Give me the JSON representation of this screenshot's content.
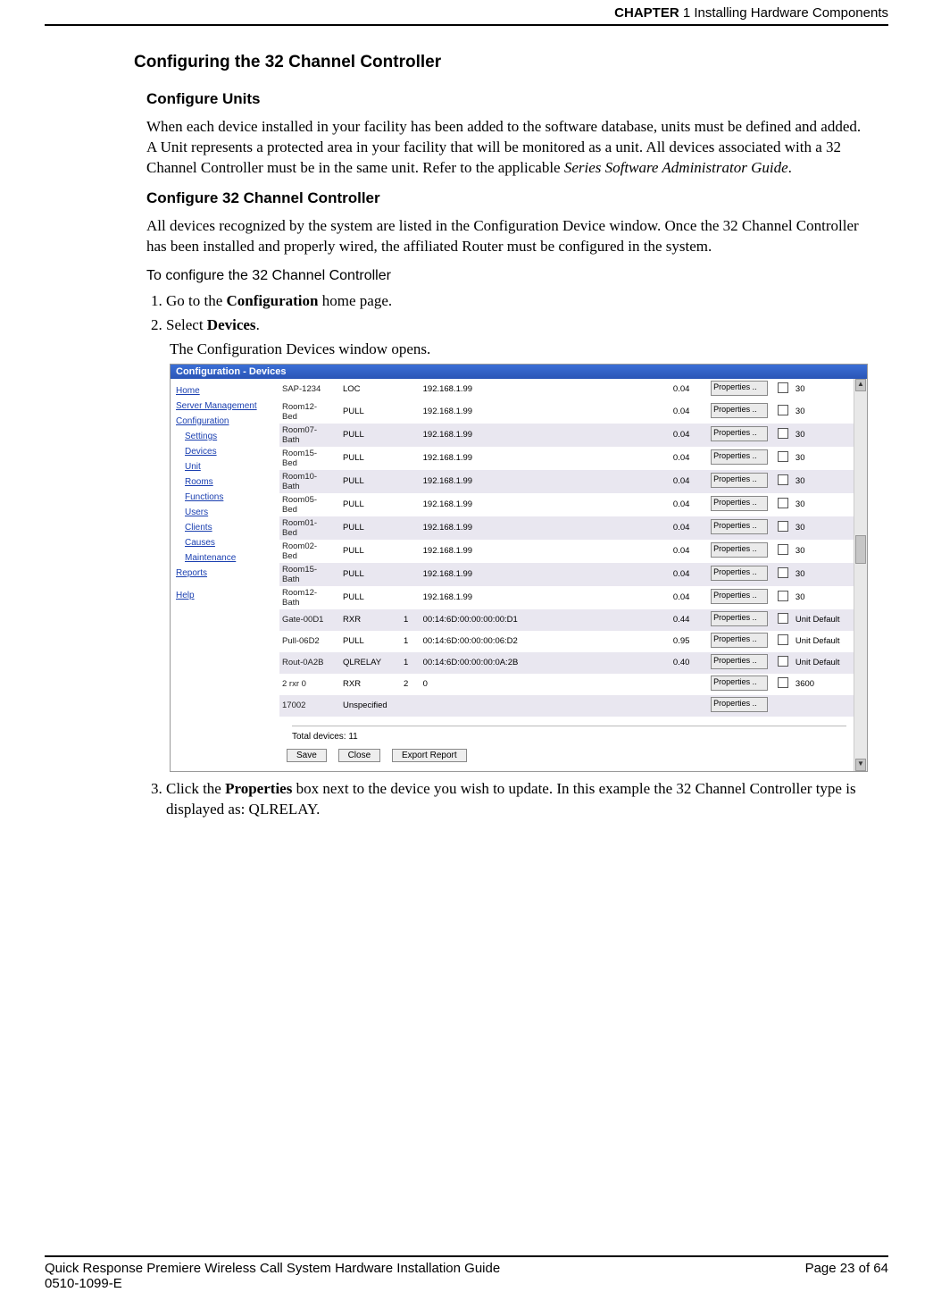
{
  "header": {
    "chapter_label": "CHAPTER",
    "chapter_num": "1",
    "chapter_title": "Installing Hardware Components"
  },
  "section": {
    "title": "Configuring the 32 Channel Controller",
    "sub1": {
      "title": "Configure Units",
      "para": "When each device installed in your facility has been added to the software database, units must be defined and added. A Unit represents a protected area in your facility that will be monitored as a unit. All devices associated with a 32 Channel Controller must be in the same unit. Refer to the applicable ",
      "para_ital": "Series Software Administrator Guide",
      "para_end": "."
    },
    "sub2": {
      "title": "Configure 32 Channel Controller",
      "para": "All devices recognized by the system are listed in the Configuration Device window. Once the 32 Channel Controller has been installed and properly wired, the affiliated Router must be configured in the system.",
      "lead": "To configure the 32 Channel Controller",
      "step1_pre": "Go to the ",
      "step1_bold": "Configuration",
      "step1_post": " home page.",
      "step2_pre": "Select ",
      "step2_bold": "Devices",
      "step2_post": ".",
      "after2": "The Configuration Devices window opens.",
      "step3_pre": "Click the ",
      "step3_bold": "Properties",
      "step3_post": " box next to the device you wish to update. In this example the 32 Channel Controller type is displayed as: QLRELAY."
    }
  },
  "shot": {
    "title": "Configuration - Devices",
    "sidebar": {
      "items": [
        {
          "label": "Home",
          "indent": false
        },
        {
          "label": "Server Management",
          "indent": false
        },
        {
          "label": "Configuration",
          "indent": false
        },
        {
          "label": "Settings",
          "indent": true
        },
        {
          "label": "Devices",
          "indent": true
        },
        {
          "label": "Unit",
          "indent": true
        },
        {
          "label": "Rooms",
          "indent": true
        },
        {
          "label": "Functions",
          "indent": true
        },
        {
          "label": "Users",
          "indent": true
        },
        {
          "label": "Clients",
          "indent": true
        },
        {
          "label": "Causes",
          "indent": true
        },
        {
          "label": "Maintenance",
          "indent": true
        },
        {
          "label": "Reports",
          "indent": false
        },
        {
          "label": "Help",
          "indent": false
        }
      ]
    },
    "prop_label": "Properties ..",
    "rows": [
      {
        "alt": false,
        "name": "SAP-1234",
        "type": "LOC",
        "n1": "",
        "addr": "192.168.1.99",
        "num": "0.04",
        "cb": true,
        "rt": "30"
      },
      {
        "alt": false,
        "name": "Room12-Bed",
        "type": "PULL",
        "n1": "",
        "addr": "192.168.1.99",
        "num": "0.04",
        "cb": true,
        "rt": "30"
      },
      {
        "alt": true,
        "name": "Room07-Bath",
        "type": "PULL",
        "n1": "",
        "addr": "192.168.1.99",
        "num": "0.04",
        "cb": true,
        "rt": "30"
      },
      {
        "alt": false,
        "name": "Room15-Bed",
        "type": "PULL",
        "n1": "",
        "addr": "192.168.1.99",
        "num": "0.04",
        "cb": true,
        "rt": "30"
      },
      {
        "alt": true,
        "name": "Room10-Bath",
        "type": "PULL",
        "n1": "",
        "addr": "192.168.1.99",
        "num": "0.04",
        "cb": true,
        "rt": "30"
      },
      {
        "alt": false,
        "name": "Room05-Bed",
        "type": "PULL",
        "n1": "",
        "addr": "192.168.1.99",
        "num": "0.04",
        "cb": true,
        "rt": "30"
      },
      {
        "alt": true,
        "name": "Room01-Bed",
        "type": "PULL",
        "n1": "",
        "addr": "192.168.1.99",
        "num": "0.04",
        "cb": true,
        "rt": "30"
      },
      {
        "alt": false,
        "name": "Room02-Bed",
        "type": "PULL",
        "n1": "",
        "addr": "192.168.1.99",
        "num": "0.04",
        "cb": true,
        "rt": "30"
      },
      {
        "alt": true,
        "name": "Room15-Bath",
        "type": "PULL",
        "n1": "",
        "addr": "192.168.1.99",
        "num": "0.04",
        "cb": true,
        "rt": "30"
      },
      {
        "alt": false,
        "name": "Room12-Bath",
        "type": "PULL",
        "n1": "",
        "addr": "192.168.1.99",
        "num": "0.04",
        "cb": true,
        "rt": "30"
      },
      {
        "alt": true,
        "name": "Gate-00D1",
        "type": "RXR",
        "n1": "1",
        "addr": "00:14:6D:00:00:00:00:D1",
        "num": "0.44",
        "cb": true,
        "rt": "Unit Default"
      },
      {
        "alt": false,
        "name": "Pull-06D2",
        "type": "PULL",
        "n1": "1",
        "addr": "00:14:6D:00:00:00:06:D2",
        "num": "0.95",
        "cb": true,
        "rt": "Unit Default"
      },
      {
        "alt": true,
        "name": "Rout-0A2B",
        "type": "QLRELAY",
        "n1": "1",
        "addr": "00:14:6D:00:00:00:0A:2B",
        "num": "0.40",
        "cb": true,
        "rt": "Unit Default"
      },
      {
        "alt": false,
        "name": "2 rxr 0",
        "type": "RXR",
        "n1": "2",
        "addr": "0",
        "num": "",
        "cb": true,
        "rt": "3600"
      },
      {
        "alt": true,
        "name": "17002",
        "type": "Unspecified",
        "n1": "",
        "addr": "",
        "num": "",
        "cb": false,
        "rt": ""
      }
    ],
    "total_label": "Total devices: 11",
    "buttons": {
      "save": "Save",
      "close": "Close",
      "export": "Export Report"
    }
  },
  "footer": {
    "left1": "Quick Response Premiere Wireless Call System Hardware Installation Guide",
    "left2": "0510-1099-E",
    "right": "Page 23 of 64"
  }
}
